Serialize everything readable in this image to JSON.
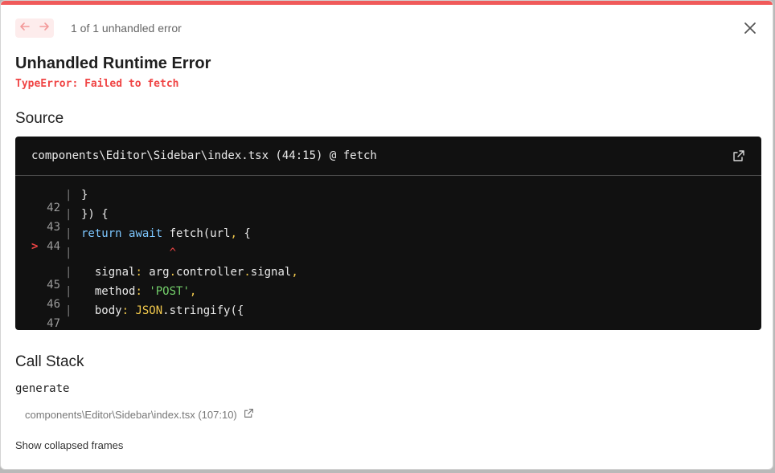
{
  "colors": {
    "accent": "#f05a5a",
    "error": "#f04545",
    "code_bg": "#111111",
    "keyword": "#7dc7ff",
    "string": "#74d06b",
    "punct": "#f2c94c"
  },
  "nav": {
    "counter_text": "1 of 1 unhandled error",
    "prev_icon": "arrow-left-icon",
    "next_icon": "arrow-right-icon",
    "close_icon": "close-icon"
  },
  "error": {
    "title": "Unhandled Runtime Error",
    "message": "TypeError: Failed to fetch"
  },
  "source": {
    "heading": "Source",
    "file_ref": "components\\Editor\\Sidebar\\index.tsx (44:15) @ fetch",
    "open_icon": "external-link-icon",
    "lines": [
      {
        "num": "42",
        "marker": "",
        "text": "}"
      },
      {
        "num": "43",
        "marker": "",
        "text": "}) {"
      },
      {
        "num": "44",
        "marker": ">",
        "text": "return await fetch(url, {"
      },
      {
        "num": "",
        "marker": "",
        "text": "             ^"
      },
      {
        "num": "45",
        "marker": "",
        "text": "  signal: arg.controller.signal,"
      },
      {
        "num": "46",
        "marker": "",
        "text": "  method: 'POST',"
      },
      {
        "num": "47",
        "marker": "",
        "text": "  body: JSON.stringify({"
      }
    ]
  },
  "call_stack": {
    "heading": "Call Stack",
    "frames": [
      {
        "function": "generate",
        "location": "components\\Editor\\Sidebar\\index.tsx (107:10)"
      }
    ],
    "show_collapsed_label": "Show collapsed frames"
  }
}
